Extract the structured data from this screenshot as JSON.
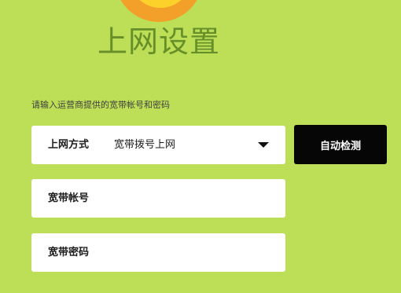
{
  "header": {
    "logo_icon": "orange-disc-logo-icon",
    "title": "上网设置"
  },
  "form": {
    "hint": "请输入运营商提供的宽带帐号和密码",
    "connection_type": {
      "label": "上网方式",
      "selected_value": "宽带拨号上网",
      "arrow_icon": "caret-down-icon"
    },
    "account": {
      "label": "宽带帐号",
      "value": ""
    },
    "password": {
      "label": "宽带密码",
      "value": ""
    },
    "detect_button_label": "自动检测"
  },
  "colors": {
    "background": "#bddf57",
    "title": "#668f29",
    "button": "#060606",
    "field": "#ffffff",
    "logo_outer": "#f3a02a",
    "logo_inner": "#fcd12a"
  }
}
